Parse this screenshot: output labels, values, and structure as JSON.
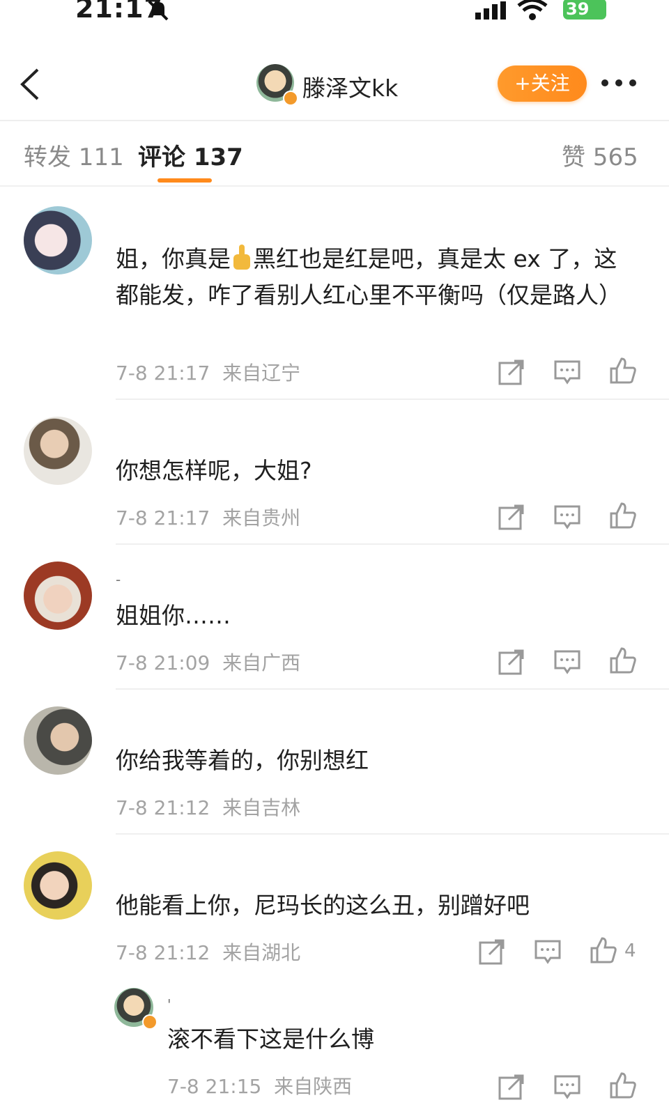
{
  "status_bar": {
    "time": "21:17",
    "battery": "39"
  },
  "header": {
    "author_name": "滕泽文kk",
    "follow_label": "+关注"
  },
  "tabs": [
    {
      "label": "转发 111"
    },
    {
      "label": "评论 137"
    },
    {
      "label": "赞 565"
    }
  ],
  "comments": [
    {
      "text_a": "姐，你真是",
      "text_b": "黑红也是红是吧，真是太 ex 了，这都能发，咋了看别人红心里不平衡吗（仅是路人）",
      "time": "7-8 21:17",
      "location": "来自辽宁"
    },
    {
      "text": "你想怎样呢，大姐?",
      "time": "7-8 21:17",
      "location": "来自贵州"
    },
    {
      "username": "-",
      "text": "姐姐你……",
      "time": "7-8 21:09",
      "location": "来自广西"
    },
    {
      "text": "你给我等着的，你别想红",
      "time": "7-8 21:12",
      "location": "来自吉林"
    },
    {
      "text": "他能看上你，尼玛长的这么丑，别蹭好吧",
      "time": "7-8 21:12",
      "location": "来自湖北",
      "likes": "4"
    }
  ],
  "reply": {
    "username": "'",
    "text": "滚不看下这是什么博",
    "time": "7-8 21:15",
    "location": "来自陕西"
  },
  "colors": {
    "accent": "#ff8a1c",
    "meta": "#a3a3a3"
  }
}
